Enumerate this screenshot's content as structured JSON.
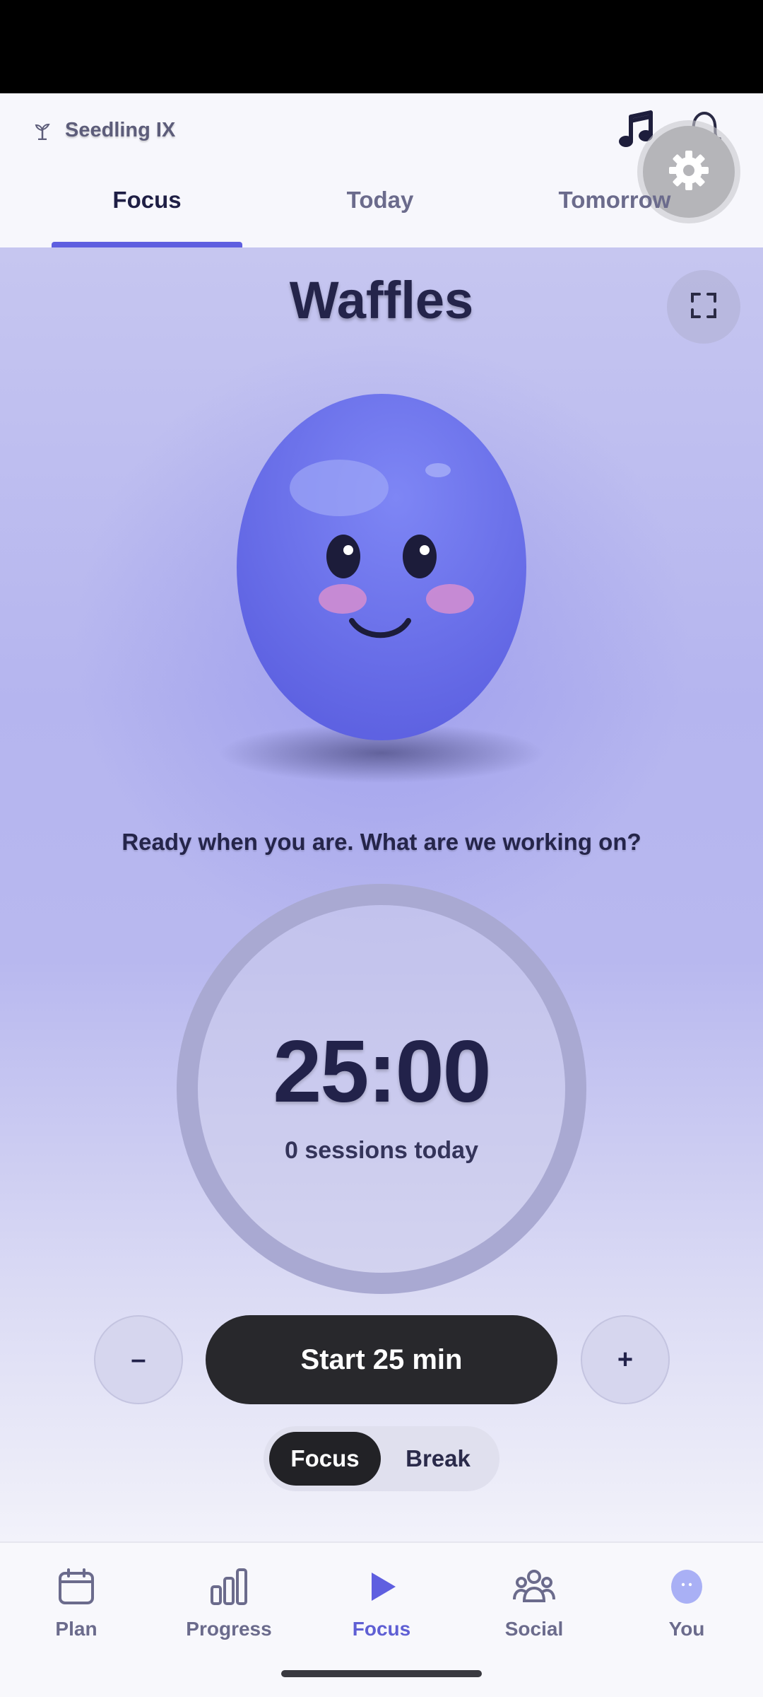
{
  "header": {
    "brand_label": "Seedling IX",
    "brand_icon": "sprout-icon",
    "music_icon": "music-note-icon",
    "bell_icon": "bell-icon",
    "settings_icon": "gear-icon"
  },
  "tabs": [
    {
      "label": "Focus",
      "active": true
    },
    {
      "label": "Today",
      "active": false
    },
    {
      "label": "Tomorrow",
      "active": false
    }
  ],
  "pet": {
    "name": "Waffles",
    "color": "#6f74ec"
  },
  "prompt": "Ready when you are. What are we working on?",
  "timer": {
    "value": "25:00",
    "sessions": "0 sessions today"
  },
  "controls": {
    "minus_label": "–",
    "start_label": "Start 25 min",
    "plus_label": "+"
  },
  "mode": {
    "focus_label": "Focus",
    "break_label": "Break",
    "selected": "Focus"
  },
  "bottom_nav": [
    {
      "label": "Plan",
      "icon": "calendar-icon",
      "active": false
    },
    {
      "label": "Progress",
      "icon": "bar-chart-icon",
      "active": false
    },
    {
      "label": "Focus",
      "icon": "play-icon",
      "active": true
    },
    {
      "label": "Social",
      "icon": "people-icon",
      "active": false
    },
    {
      "label": "You",
      "icon": "avatar-icon",
      "active": false
    }
  ],
  "colors": {
    "accent": "#5f5fe0",
    "dark_button": "#28282c"
  }
}
